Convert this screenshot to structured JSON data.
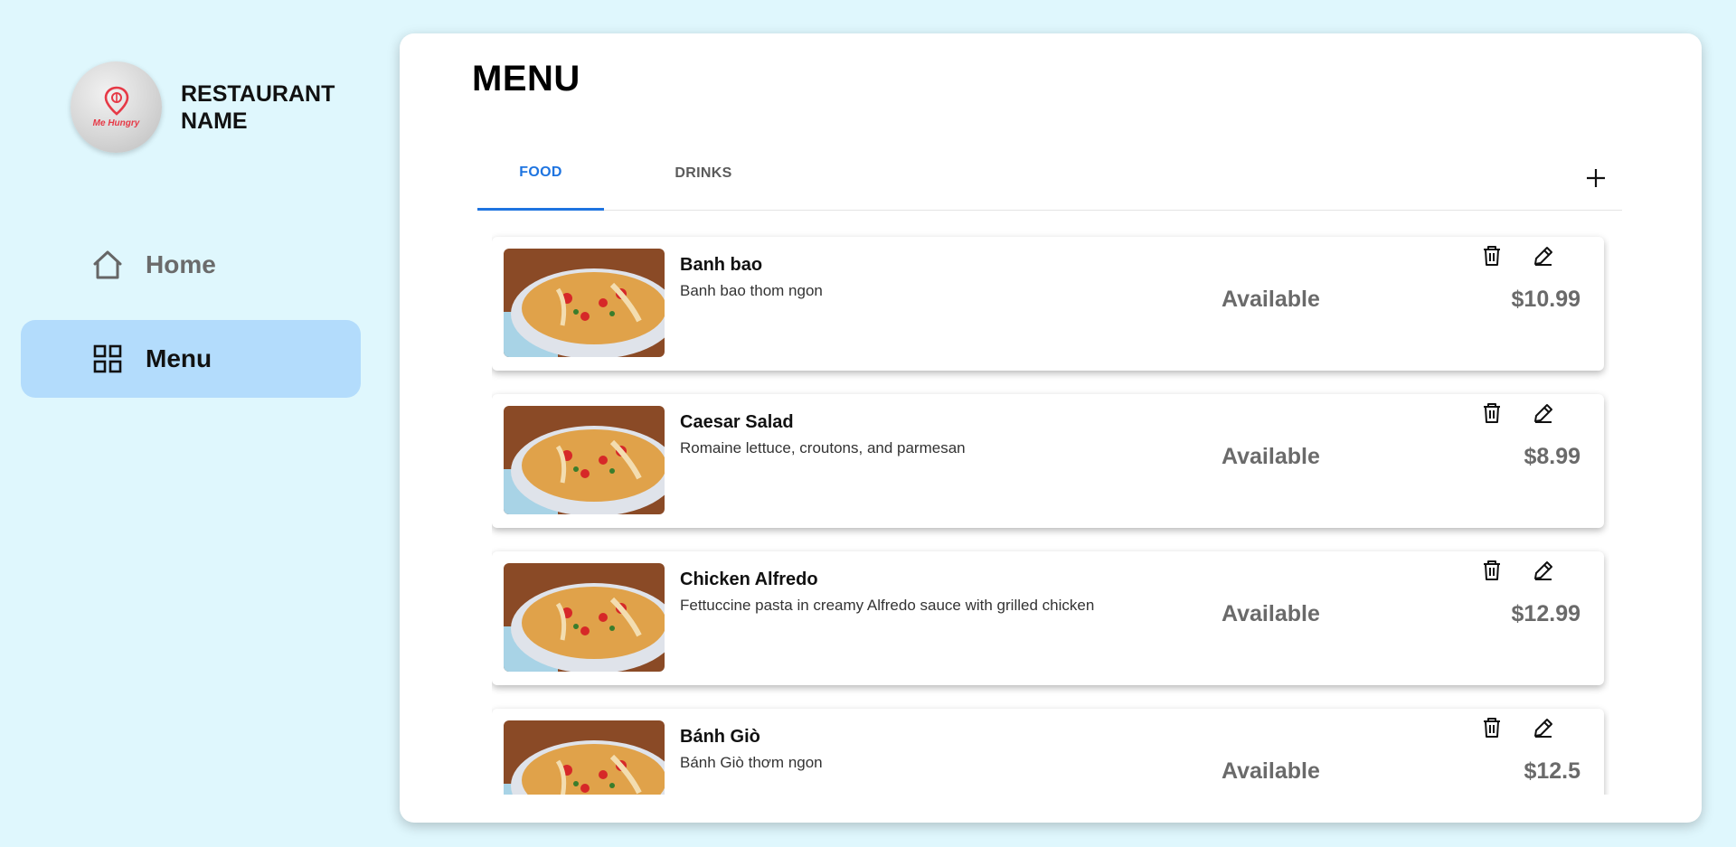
{
  "sidebar": {
    "logo_text": "Me Hungry",
    "restaurant_name": "RESTAURANT\nNAME",
    "nav": [
      {
        "label": "Home",
        "icon": "home-icon",
        "active": false
      },
      {
        "label": "Menu",
        "icon": "grid-icon",
        "active": true
      }
    ]
  },
  "main": {
    "title": "MENU",
    "tabs": [
      {
        "label": "FOOD",
        "active": true
      },
      {
        "label": "DRINKS",
        "active": false
      }
    ],
    "add_icon": "plus-icon"
  },
  "items": [
    {
      "name": "Banh bao",
      "description": "Banh bao thom ngon",
      "status": "Available",
      "price": "$10.99"
    },
    {
      "name": "Caesar Salad",
      "description": "Romaine lettuce, croutons, and parmesan",
      "status": "Available",
      "price": "$8.99"
    },
    {
      "name": "Chicken Alfredo",
      "description": "Fettuccine pasta in creamy Alfredo sauce with grilled chicken",
      "status": "Available",
      "price": "$12.99"
    },
    {
      "name": "Bánh Giò",
      "description": "Bánh Giò thơm ngon",
      "status": "Available",
      "price": "$12.5"
    }
  ],
  "colors": {
    "background": "#dff7fd",
    "accent": "#1e74e0",
    "nav_active": "#b3dcfc",
    "logo_red": "#e63946"
  }
}
